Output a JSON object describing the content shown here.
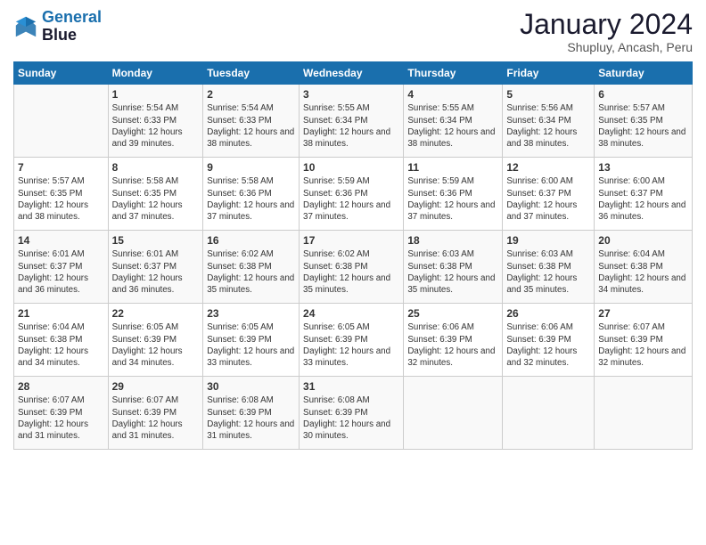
{
  "header": {
    "logo_line1": "General",
    "logo_line2": "Blue",
    "main_title": "January 2024",
    "subtitle": "Shupluy, Ancash, Peru"
  },
  "days_of_week": [
    "Sunday",
    "Monday",
    "Tuesday",
    "Wednesday",
    "Thursday",
    "Friday",
    "Saturday"
  ],
  "weeks": [
    [
      {
        "day": "",
        "sunrise": "",
        "sunset": "",
        "daylight": ""
      },
      {
        "day": "1",
        "sunrise": "Sunrise: 5:54 AM",
        "sunset": "Sunset: 6:33 PM",
        "daylight": "Daylight: 12 hours and 39 minutes."
      },
      {
        "day": "2",
        "sunrise": "Sunrise: 5:54 AM",
        "sunset": "Sunset: 6:33 PM",
        "daylight": "Daylight: 12 hours and 38 minutes."
      },
      {
        "day": "3",
        "sunrise": "Sunrise: 5:55 AM",
        "sunset": "Sunset: 6:34 PM",
        "daylight": "Daylight: 12 hours and 38 minutes."
      },
      {
        "day": "4",
        "sunrise": "Sunrise: 5:55 AM",
        "sunset": "Sunset: 6:34 PM",
        "daylight": "Daylight: 12 hours and 38 minutes."
      },
      {
        "day": "5",
        "sunrise": "Sunrise: 5:56 AM",
        "sunset": "Sunset: 6:34 PM",
        "daylight": "Daylight: 12 hours and 38 minutes."
      },
      {
        "day": "6",
        "sunrise": "Sunrise: 5:57 AM",
        "sunset": "Sunset: 6:35 PM",
        "daylight": "Daylight: 12 hours and 38 minutes."
      }
    ],
    [
      {
        "day": "7",
        "sunrise": "Sunrise: 5:57 AM",
        "sunset": "Sunset: 6:35 PM",
        "daylight": "Daylight: 12 hours and 38 minutes."
      },
      {
        "day": "8",
        "sunrise": "Sunrise: 5:58 AM",
        "sunset": "Sunset: 6:35 PM",
        "daylight": "Daylight: 12 hours and 37 minutes."
      },
      {
        "day": "9",
        "sunrise": "Sunrise: 5:58 AM",
        "sunset": "Sunset: 6:36 PM",
        "daylight": "Daylight: 12 hours and 37 minutes."
      },
      {
        "day": "10",
        "sunrise": "Sunrise: 5:59 AM",
        "sunset": "Sunset: 6:36 PM",
        "daylight": "Daylight: 12 hours and 37 minutes."
      },
      {
        "day": "11",
        "sunrise": "Sunrise: 5:59 AM",
        "sunset": "Sunset: 6:36 PM",
        "daylight": "Daylight: 12 hours and 37 minutes."
      },
      {
        "day": "12",
        "sunrise": "Sunrise: 6:00 AM",
        "sunset": "Sunset: 6:37 PM",
        "daylight": "Daylight: 12 hours and 37 minutes."
      },
      {
        "day": "13",
        "sunrise": "Sunrise: 6:00 AM",
        "sunset": "Sunset: 6:37 PM",
        "daylight": "Daylight: 12 hours and 36 minutes."
      }
    ],
    [
      {
        "day": "14",
        "sunrise": "Sunrise: 6:01 AM",
        "sunset": "Sunset: 6:37 PM",
        "daylight": "Daylight: 12 hours and 36 minutes."
      },
      {
        "day": "15",
        "sunrise": "Sunrise: 6:01 AM",
        "sunset": "Sunset: 6:37 PM",
        "daylight": "Daylight: 12 hours and 36 minutes."
      },
      {
        "day": "16",
        "sunrise": "Sunrise: 6:02 AM",
        "sunset": "Sunset: 6:38 PM",
        "daylight": "Daylight: 12 hours and 35 minutes."
      },
      {
        "day": "17",
        "sunrise": "Sunrise: 6:02 AM",
        "sunset": "Sunset: 6:38 PM",
        "daylight": "Daylight: 12 hours and 35 minutes."
      },
      {
        "day": "18",
        "sunrise": "Sunrise: 6:03 AM",
        "sunset": "Sunset: 6:38 PM",
        "daylight": "Daylight: 12 hours and 35 minutes."
      },
      {
        "day": "19",
        "sunrise": "Sunrise: 6:03 AM",
        "sunset": "Sunset: 6:38 PM",
        "daylight": "Daylight: 12 hours and 35 minutes."
      },
      {
        "day": "20",
        "sunrise": "Sunrise: 6:04 AM",
        "sunset": "Sunset: 6:38 PM",
        "daylight": "Daylight: 12 hours and 34 minutes."
      }
    ],
    [
      {
        "day": "21",
        "sunrise": "Sunrise: 6:04 AM",
        "sunset": "Sunset: 6:38 PM",
        "daylight": "Daylight: 12 hours and 34 minutes."
      },
      {
        "day": "22",
        "sunrise": "Sunrise: 6:05 AM",
        "sunset": "Sunset: 6:39 PM",
        "daylight": "Daylight: 12 hours and 34 minutes."
      },
      {
        "day": "23",
        "sunrise": "Sunrise: 6:05 AM",
        "sunset": "Sunset: 6:39 PM",
        "daylight": "Daylight: 12 hours and 33 minutes."
      },
      {
        "day": "24",
        "sunrise": "Sunrise: 6:05 AM",
        "sunset": "Sunset: 6:39 PM",
        "daylight": "Daylight: 12 hours and 33 minutes."
      },
      {
        "day": "25",
        "sunrise": "Sunrise: 6:06 AM",
        "sunset": "Sunset: 6:39 PM",
        "daylight": "Daylight: 12 hours and 32 minutes."
      },
      {
        "day": "26",
        "sunrise": "Sunrise: 6:06 AM",
        "sunset": "Sunset: 6:39 PM",
        "daylight": "Daylight: 12 hours and 32 minutes."
      },
      {
        "day": "27",
        "sunrise": "Sunrise: 6:07 AM",
        "sunset": "Sunset: 6:39 PM",
        "daylight": "Daylight: 12 hours and 32 minutes."
      }
    ],
    [
      {
        "day": "28",
        "sunrise": "Sunrise: 6:07 AM",
        "sunset": "Sunset: 6:39 PM",
        "daylight": "Daylight: 12 hours and 31 minutes."
      },
      {
        "day": "29",
        "sunrise": "Sunrise: 6:07 AM",
        "sunset": "Sunset: 6:39 PM",
        "daylight": "Daylight: 12 hours and 31 minutes."
      },
      {
        "day": "30",
        "sunrise": "Sunrise: 6:08 AM",
        "sunset": "Sunset: 6:39 PM",
        "daylight": "Daylight: 12 hours and 31 minutes."
      },
      {
        "day": "31",
        "sunrise": "Sunrise: 6:08 AM",
        "sunset": "Sunset: 6:39 PM",
        "daylight": "Daylight: 12 hours and 30 minutes."
      },
      {
        "day": "",
        "sunrise": "",
        "sunset": "",
        "daylight": ""
      },
      {
        "day": "",
        "sunrise": "",
        "sunset": "",
        "daylight": ""
      },
      {
        "day": "",
        "sunrise": "",
        "sunset": "",
        "daylight": ""
      }
    ]
  ]
}
